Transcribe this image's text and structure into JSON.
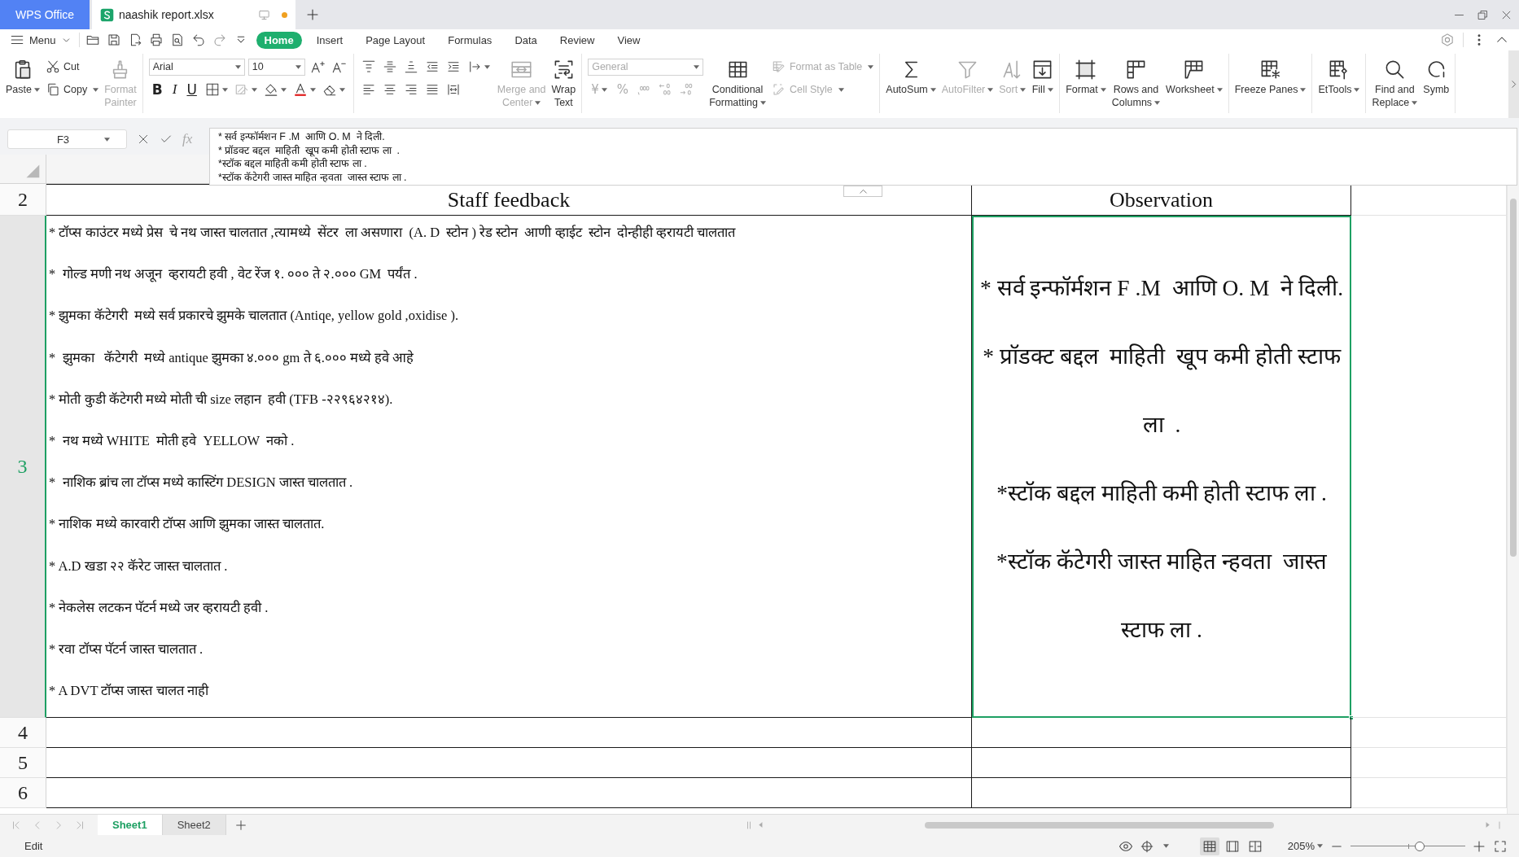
{
  "title_bar": {
    "tabs": [
      {
        "kind": "app",
        "label": "WPS Office",
        "selected": false
      },
      {
        "kind": "file",
        "label": "naashik report.xlsx",
        "selected": true,
        "modified": true
      }
    ]
  },
  "menu_bar": {
    "menu_label": "Menu",
    "tabs": [
      {
        "label": "Home",
        "selected": true
      },
      {
        "label": "Insert",
        "selected": false
      },
      {
        "label": "Page Layout",
        "selected": false
      },
      {
        "label": "Formulas",
        "selected": false
      },
      {
        "label": "Data",
        "selected": false
      },
      {
        "label": "Review",
        "selected": false
      },
      {
        "label": "View",
        "selected": false
      }
    ]
  },
  "ribbon": {
    "groups": [
      {
        "blocks": [
          {
            "kind": "large",
            "label": "Paste",
            "dropdown": true,
            "disabled": false
          },
          {
            "kind": "stack",
            "rows": [
              [
                {
                  "kind": "small",
                  "label": "Cut",
                  "dropdown": false,
                  "disabled": false
                }
              ],
              [
                {
                  "kind": "small",
                  "label": "Copy",
                  "dropdown": true,
                  "disabled": false
                }
              ]
            ]
          },
          {
            "kind": "large",
            "label": "Format\nPainter",
            "dropdown": false,
            "disabled": true
          }
        ]
      },
      {
        "blocks": [
          {
            "kind": "stack",
            "rows": [
              [
                {
                  "kind": "field",
                  "value": "Arial",
                  "dropdown": true,
                  "disabled": false
                },
                {
                  "kind": "field",
                  "value": "10",
                  "dropdown": true,
                  "disabled": false
                },
                {
                  "kind": "tool",
                  "dropdown": false,
                  "disabled": false
                },
                {
                  "kind": "tool",
                  "dropdown": false,
                  "disabled": false
                }
              ],
              [
                {
                  "kind": "bold",
                  "label": "B",
                  "dropdown": false,
                  "disabled": false
                },
                {
                  "kind": "italic",
                  "label": "I",
                  "dropdown": false,
                  "disabled": false
                },
                {
                  "kind": "underline",
                  "label": "U",
                  "dropdown": false,
                  "disabled": false
                },
                {
                  "kind": "tool",
                  "dropdown": true,
                  "disabled": false
                },
                {
                  "kind": "tool",
                  "dropdown": true,
                  "disabled": true
                },
                {
                  "kind": "tool",
                  "dropdown": true,
                  "disabled": false
                },
                {
                  "kind": "tool",
                  "dropdown": true,
                  "disabled": false
                },
                {
                  "kind": "tool",
                  "dropdown": true,
                  "disabled": false
                }
              ]
            ]
          }
        ]
      },
      {
        "blocks": [
          {
            "kind": "stack",
            "rows": [
              [
                {
                  "kind": "tool",
                  "dropdown": false,
                  "disabled": false
                },
                {
                  "kind": "tool",
                  "dropdown": false,
                  "disabled": false
                },
                {
                  "kind": "tool",
                  "dropdown": false,
                  "disabled": false
                },
                {
                  "kind": "tool",
                  "dropdown": false,
                  "disabled": false
                },
                {
                  "kind": "tool",
                  "dropdown": false,
                  "disabled": false
                },
                {
                  "kind": "tool",
                  "dropdown": true,
                  "disabled": false
                }
              ],
              [
                {
                  "kind": "tool",
                  "dropdown": false,
                  "disabled": false
                },
                {
                  "kind": "tool",
                  "dropdown": false,
                  "disabled": false
                },
                {
                  "kind": "tool",
                  "dropdown": false,
                  "disabled": false
                },
                {
                  "kind": "tool",
                  "dropdown": false,
                  "disabled": false
                },
                {
                  "kind": "tool",
                  "dropdown": false,
                  "disabled": false
                }
              ]
            ]
          },
          {
            "kind": "large",
            "label": "Merge and\nCenter",
            "dropdown": true,
            "disabled": true
          },
          {
            "kind": "large",
            "label": "Wrap\nText",
            "dropdown": false,
            "disabled": false
          }
        ]
      },
      {
        "blocks": [
          {
            "kind": "stack",
            "rows": [
              [
                {
                  "kind": "field",
                  "value": "General",
                  "dropdown": true,
                  "disabled": true
                }
              ],
              [
                {
                  "kind": "glyph",
                  "label": "¥",
                  "dropdown": true,
                  "disabled": true
                },
                {
                  "kind": "glyph",
                  "label": "%",
                  "dropdown": false,
                  "disabled": true
                },
                {
                  "kind": "tool",
                  "dropdown": false,
                  "disabled": true
                },
                {
                  "kind": "tool",
                  "dropdown": false,
                  "disabled": true
                },
                {
                  "kind": "tool",
                  "dropdown": false,
                  "disabled": true
                }
              ]
            ]
          },
          {
            "kind": "large",
            "label": "Conditional\nFormatting",
            "dropdown": true,
            "disabled": false
          },
          {
            "kind": "stack",
            "rows": [
              [
                {
                  "kind": "small",
                  "label": "Format as Table",
                  "dropdown": true,
                  "disabled": true
                }
              ],
              [
                {
                  "kind": "small",
                  "label": "Cell Style",
                  "dropdown": true,
                  "disabled": true
                }
              ]
            ]
          }
        ]
      },
      {
        "blocks": [
          {
            "kind": "large",
            "label": "AutoSum",
            "dropdown": true,
            "disabled": false
          },
          {
            "kind": "large",
            "label": "AutoFilter",
            "dropdown": true,
            "disabled": true
          },
          {
            "kind": "large",
            "label": "Sort",
            "dropdown": true,
            "disabled": true
          },
          {
            "kind": "large",
            "label": "Fill",
            "dropdown": true,
            "disabled": false
          }
        ]
      },
      {
        "blocks": [
          {
            "kind": "large",
            "label": "Format",
            "dropdown": true,
            "disabled": false
          },
          {
            "kind": "large",
            "label": "Rows and\nColumns",
            "dropdown": true,
            "disabled": false
          },
          {
            "kind": "large",
            "label": "Worksheet",
            "dropdown": true,
            "disabled": false
          }
        ]
      },
      {
        "blocks": [
          {
            "kind": "large",
            "label": "Freeze Panes",
            "dropdown": true,
            "disabled": false
          }
        ]
      },
      {
        "blocks": [
          {
            "kind": "large",
            "label": "EtTools",
            "dropdown": true,
            "disabled": false
          }
        ]
      },
      {
        "blocks": [
          {
            "kind": "large",
            "label": "Find and\nReplace",
            "dropdown": true,
            "disabled": false
          },
          {
            "kind": "large",
            "label": "Symb",
            "dropdown": false,
            "disabled": false
          }
        ]
      }
    ]
  },
  "formula_bar": {
    "name_box": "F3",
    "function_label": "fx",
    "formula": "* सर्व इन्फॉर्मशन F .M  आणि O. M  ने दिली.\n* प्रॉडक्ट बद्दल  माहिती  खूप कमी होती स्टाफ ला  .\n*स्टॉक बद्दल माहिती कमी होती स्टाफ ला .\n*स्टॉक कॅटेगरी जास्त माहित न्हवता  जास्त स्टाफ ला ."
  },
  "sheet": {
    "rows": [
      {
        "number": "2",
        "selected": false,
        "kind": "heading",
        "cells": [
          {
            "text": "Staff feedback",
            "selected": false
          },
          {
            "text": "Observation",
            "selected": false
          }
        ]
      },
      {
        "number": "3",
        "selected": true,
        "kind": "body",
        "cells": [
          {
            "kind": "lines",
            "selected": false,
            "lines": [
              "* टॉप्स काउंटर मध्ये प्रेस  चे नथ जास्त चालतात ,त्यामध्ये  सेंटर  ला असणारा  (A. D  स्टोन ) रेड स्टोन  आणी व्हाईट  स्टोन  दोन्हीही व्हरायटी चालतात",
              "*  गोल्ड मणी नथ अजून  व्हरायटी हवी , वेट रेंज १. ००० ते २.००० GM  पर्यंत .",
              "* झुमका कॅटेगरी  मध्ये सर्व प्रकारचे झुमके चालतात (Antiqe, yellow gold ,oxidise ).",
              "*  झुमका   कॅटेगरी  मध्ये antique झुमका ४.००० gm ते ६.००० मध्ये हवे आहे",
              "* मोती कुडी कॅटेगरी मध्ये मोती ची size लहान  हवी (TFB -२२९६४२१४).",
              "*  नथ मध्ये WHITE  मोती हवे  YELLOW  नको .",
              "*  नाशिक ब्रांच ला टॉप्स मध्ये कास्टिंग DESIGN जास्त चालतात .",
              "* नाशिक मध्ये कारवारी टॉप्स आणि झुमका जास्त चालतात.",
              "* A.D खडा २२ कॅरेट जास्त चालतात .",
              "* नेकलेस लटकन पॅटर्न मध्ये जर व्हरायटी हवी .",
              "* रवा टॉप्स पॅटर्न जास्त चालतात .",
              "* A DVT टॉप्स जास्त चालत नाही"
            ]
          },
          {
            "kind": "paragraphs",
            "selected": true,
            "lines": [
              "* सर्व इन्फॉर्मशन F .M  आणि O. M  ने दिली.",
              "* प्रॉडक्ट बद्दल  माहिती  खूप कमी होती स्टाफ ला  .",
              "*स्टॉक बद्दल माहिती कमी होती स्टाफ ला .",
              "*स्टॉक कॅटेगरी जास्त माहित न्हवता  जास्त स्टाफ ला ."
            ]
          }
        ]
      },
      {
        "number": "4",
        "selected": false,
        "kind": "empty"
      },
      {
        "number": "5",
        "selected": false,
        "kind": "empty"
      },
      {
        "number": "6",
        "selected": false,
        "kind": "empty"
      }
    ],
    "tabs": [
      {
        "label": "Sheet1",
        "selected": true
      },
      {
        "label": "Sheet2",
        "selected": false
      }
    ]
  },
  "status_bar": {
    "mode": "Edit",
    "view_modes": [
      {
        "selected": true
      },
      {
        "selected": false
      },
      {
        "selected": false
      }
    ],
    "zoom": "205%",
    "zoom_slider": {
      "level": 0.6
    }
  }
}
